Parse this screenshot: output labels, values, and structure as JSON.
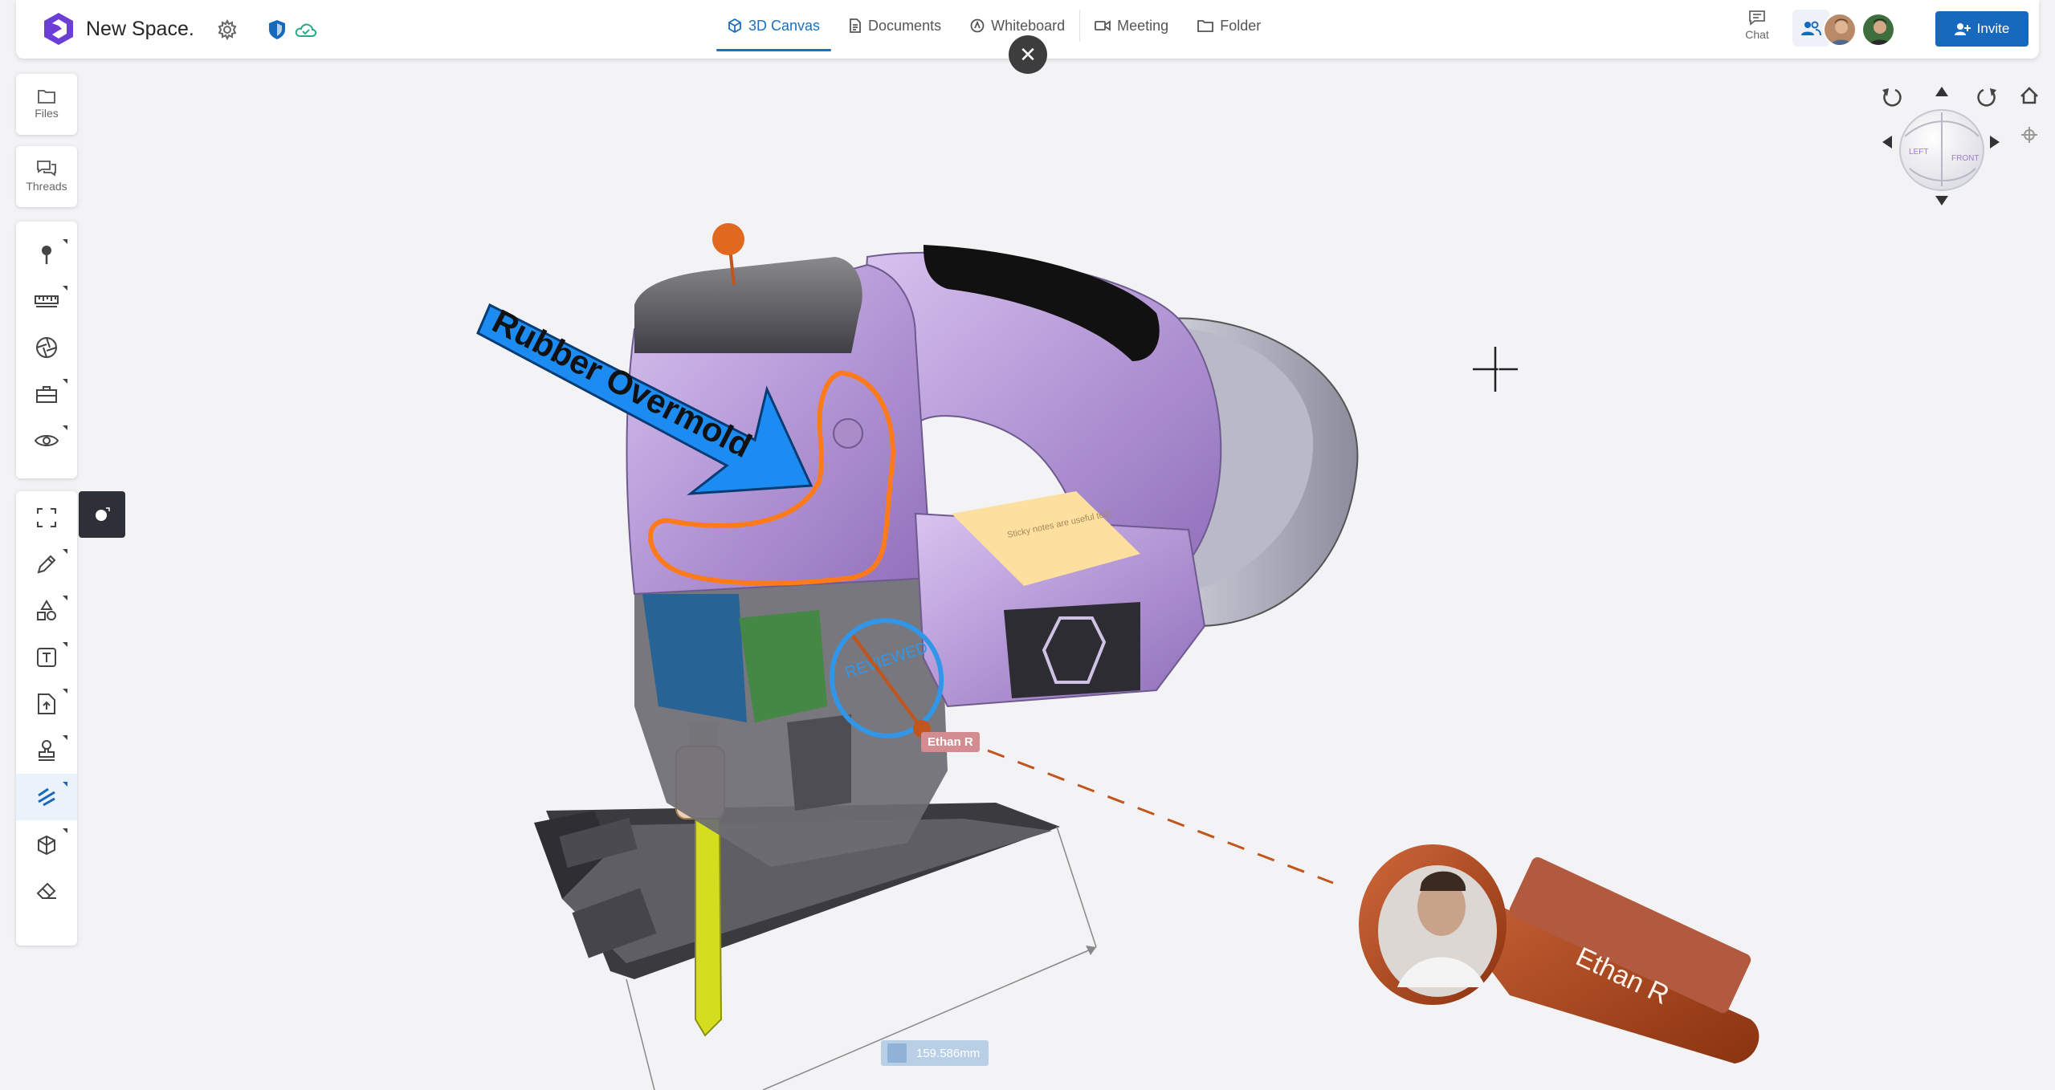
{
  "header": {
    "title": "New Space.",
    "tabs": [
      {
        "label": "3D Canvas",
        "active": true
      },
      {
        "label": "Documents",
        "active": false
      },
      {
        "label": "Whiteboard",
        "active": false
      },
      {
        "label": "Meeting",
        "active": false
      },
      {
        "label": "Folder",
        "active": false
      }
    ],
    "chat_label": "Chat",
    "invite_label": "Invite"
  },
  "sidebar": {
    "files_label": "Files",
    "threads_label": "Threads",
    "tool_icons": [
      "pin-icon",
      "ruler-icon",
      "aperture-icon",
      "toolbox-icon",
      "eye-icon",
      "fullscreen-icon",
      "pencil-icon",
      "shapes-icon",
      "text-icon",
      "upload-icon",
      "stamp-icon",
      "link-icon",
      "explode-icon",
      "eraser-icon"
    ]
  },
  "canvas": {
    "annotation_arrow_text": "Rubber Overmold",
    "stamp_text": "REVIEWED",
    "sticky_note_text": "Sticky notes are useful too!",
    "cursor_user_label": "Ethan R",
    "avatar_label": "Ethan R",
    "measurement": "159.586mm",
    "nav_cube_faces": [
      "LEFT",
      "FRONT"
    ]
  },
  "colors": {
    "accent": "#1769bd",
    "body_purple": "#b79ad6",
    "annotation_orange": "#ff7a1a",
    "arrow_blue": "#1d8cf2",
    "stamp_blue": "#3296e8",
    "sticky": "#fde0a0",
    "avatar_rust": "#b3471f"
  }
}
